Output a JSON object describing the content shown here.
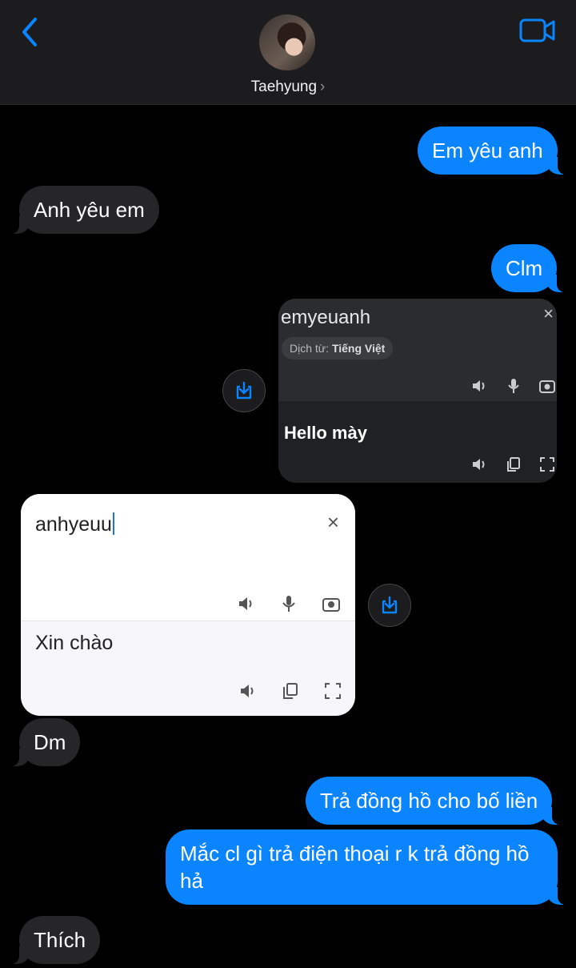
{
  "header": {
    "contact_name": "Taehyung",
    "chevron": "›",
    "back_icon": "chevron-left-icon",
    "video_icon": "video-call-icon",
    "accent": "#0a84ff"
  },
  "messages": [
    {
      "side": "out",
      "text": "Em yêu anh"
    },
    {
      "side": "in",
      "text": "Anh yêu em"
    },
    {
      "side": "out",
      "text": "Clm"
    },
    {
      "side": "in",
      "text": "Dm"
    },
    {
      "side": "out",
      "text": "Trả đồng hồ cho bố liền"
    },
    {
      "side": "out",
      "text": "Mắc cl gì trả điện thoại r k trả đồng hồ hả"
    },
    {
      "side": "in",
      "text": "Thích"
    }
  ],
  "translate_dark": {
    "source_text": "emyeuanh",
    "detected_prefix": "Dịch từ:",
    "detected_lang": "Tiếng Việt",
    "close": "×",
    "result_text": "Hello mày"
  },
  "translate_light": {
    "source_text": "anhyeuu",
    "close": "×",
    "result_text": "Xin chào"
  },
  "colors": {
    "outgoing_bubble": "#0a84ff",
    "incoming_bubble": "#262628",
    "background": "#000000"
  }
}
